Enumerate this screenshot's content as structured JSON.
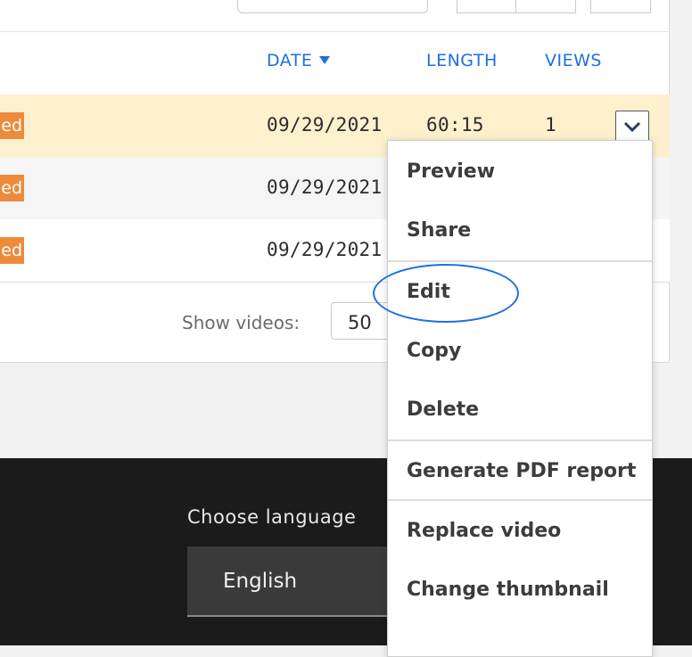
{
  "table": {
    "columns": {
      "date": "DATE",
      "length": "LENGTH",
      "views": "VIEWS"
    },
    "rows": [
      {
        "badge": "ed",
        "date": "09/29/2021",
        "length": "60:15",
        "views": "1"
      },
      {
        "badge": "ed",
        "date": "09/29/2021"
      },
      {
        "badge": "ed",
        "date": "09/29/2021"
      }
    ]
  },
  "pagination": {
    "show_label": "Show videos:",
    "show_value": "50"
  },
  "footer": {
    "language_label": "Choose language",
    "language_value": "English"
  },
  "menu": {
    "items": [
      "Preview",
      "Share",
      "Edit",
      "Copy",
      "Delete",
      "Generate PDF report",
      "Replace video",
      "Change thumbnail"
    ]
  },
  "colors": {
    "accent": "#1f6fe0",
    "badge": "#ee8a3c",
    "highlight_row": "#fdf0cd",
    "footer_bg": "#1b1b1b"
  },
  "icons": {
    "sort": "caret-down-icon",
    "row_menu": "chevron-down-icon"
  }
}
